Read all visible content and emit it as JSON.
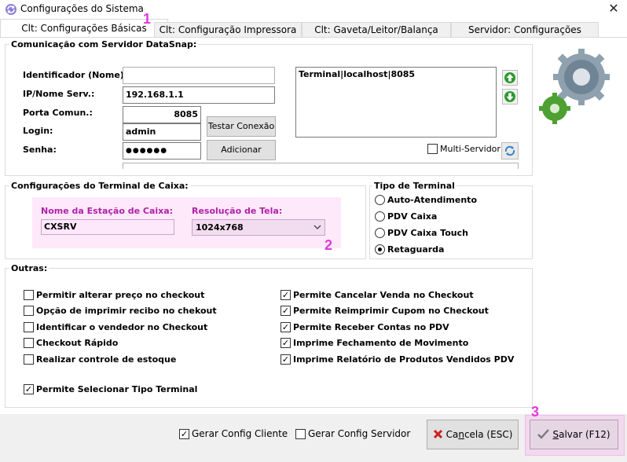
{
  "window": {
    "title": "Configurações do Sistema",
    "close_glyph": "✕",
    "icon": "refresh-app-icon"
  },
  "tabs": [
    {
      "label": "Clt: Configurações Básicas",
      "active": true
    },
    {
      "label": "Clt: Configuração Impressora",
      "active": false
    },
    {
      "label": "Clt: Gaveta/Leitor/Balança",
      "active": false
    },
    {
      "label": "Servidor: Configurações",
      "active": false
    }
  ],
  "annotations": {
    "n1": "1",
    "n2": "2",
    "n3": "3",
    "color": "#e03ad9"
  },
  "datasnap": {
    "group_title": "Comunicação com Servidor DataSnap:",
    "id_label": "Identificador (Nome):",
    "id_value": "",
    "ip_label": "IP/Nome Serv.:",
    "ip_value": "192.168.1.1",
    "port_label": "Porta Comun.:",
    "port_value": "8085",
    "login_label": "Login:",
    "login_value": "admin",
    "password_label": "Senha:",
    "password_value": "●●●●●●",
    "test_button": "Testar Conexão",
    "add_button": "Adicionar",
    "server_list": [
      "Terminal|localhost|8085"
    ],
    "multi_server_label": "Multi-Servidor",
    "multi_server_checked": false
  },
  "terminal_config": {
    "group_title": "Configurações do Terminal de Caixa:",
    "station_label": "Nome da Estação de Caixa:",
    "station_value": "CXSRV",
    "resolution_label": "Resolução de Tela:",
    "resolution_value": "1024x768"
  },
  "terminal_type": {
    "group_title": "Tipo de Terminal",
    "options": [
      {
        "label": "Auto-Atendimento",
        "selected": false
      },
      {
        "label": "PDV Caixa",
        "selected": false
      },
      {
        "label": "PDV Caixa Touch",
        "selected": false
      },
      {
        "label": "Retaguarda",
        "selected": true
      }
    ]
  },
  "outras": {
    "group_title": "Outras:",
    "left": [
      {
        "label": "Permitir alterar preço no checkout",
        "checked": false
      },
      {
        "label": "Opção de imprimir recibo no chekout",
        "checked": false
      },
      {
        "label": "Identificar o vendedor no Checkout",
        "checked": false
      },
      {
        "label": "Checkout Rápido",
        "checked": false
      },
      {
        "label": "Realizar controle de estoque",
        "checked": false
      }
    ],
    "right": [
      {
        "label": "Permite Cancelar Venda no Checkout",
        "checked": true
      },
      {
        "label": "Permite Reimprimir Cupom no Checkout",
        "checked": true
      },
      {
        "label": "Permite Receber Contas no PDV",
        "checked": true
      },
      {
        "label": "Imprime Fechamento de Movimento",
        "checked": true
      },
      {
        "label": "Imprime Relatório de Produtos Vendidos PDV",
        "checked": true
      }
    ],
    "extra": {
      "label": "Permite Selecionar Tipo Terminal",
      "checked": true
    }
  },
  "footer": {
    "gen_client_label": "Gerar Config Cliente",
    "gen_client_checked": true,
    "gen_server_label": "Gerar Config Servidor",
    "gen_server_checked": false,
    "cancel_pre": "Ca",
    "cancel_u": "n",
    "cancel_post": "cela (ESC)",
    "save_u": "S",
    "save_post": "alvar (F12)",
    "check_glyph": "✓"
  }
}
